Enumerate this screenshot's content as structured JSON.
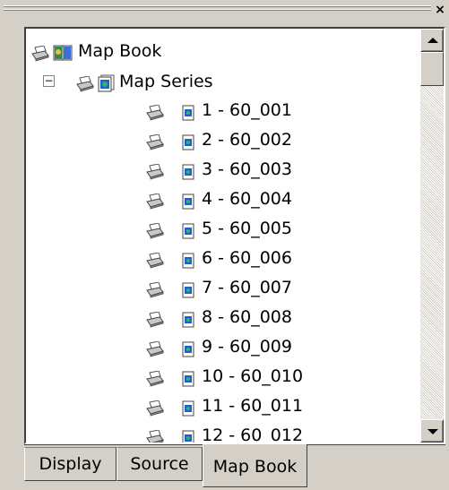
{
  "window": {
    "close_glyph": "×"
  },
  "tree": {
    "root": {
      "label": "Map Book",
      "icons": [
        "printer-icon",
        "map-book-icon"
      ]
    },
    "series": {
      "label": "Map Series",
      "expander": "−",
      "icons": [
        "printer-icon",
        "map-series-icon"
      ]
    },
    "pages": [
      {
        "label": "1 - 60_001"
      },
      {
        "label": "2 - 60_002"
      },
      {
        "label": "3 - 60_003"
      },
      {
        "label": "4 - 60_004"
      },
      {
        "label": "5 - 60_005"
      },
      {
        "label": "6 - 60_006"
      },
      {
        "label": "7 - 60_007"
      },
      {
        "label": "8 - 60_008"
      },
      {
        "label": "9 - 60_009"
      },
      {
        "label": "10 - 60_010"
      },
      {
        "label": "11 - 60_011"
      },
      {
        "label": "12 - 60_012"
      }
    ]
  },
  "tabs": [
    {
      "label": "Display",
      "active": false
    },
    {
      "label": "Source",
      "active": false
    },
    {
      "label": "Map Book",
      "active": true
    }
  ],
  "colors": {
    "panel": "#d4d0c8",
    "tree_bg": "#ffffff",
    "page_icon": "#1f5fd6"
  }
}
